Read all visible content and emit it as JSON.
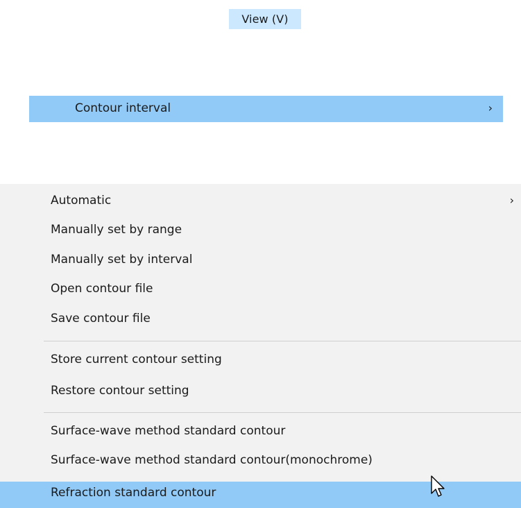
{
  "menubar": {
    "view_label": "View (V)"
  },
  "parent_menu": {
    "contour_interval_label": "Contour interval",
    "contour_interval_arrow": "›"
  },
  "submenu": {
    "automatic": "Automatic",
    "automatic_arrow": "›",
    "manual_range": "Manually set by range",
    "manual_interval": "Manually set by interval",
    "open_file": "Open contour file",
    "save_file": "Save contour file",
    "store_setting": "Store current contour setting",
    "restore_setting": "Restore contour setting",
    "surface_wave_standard": "Surface-wave method standard contour",
    "surface_wave_mono": "Surface-wave method standard contour(monochrome)",
    "refraction_standard": "Refraction standard contour"
  },
  "colors": {
    "highlight": "#91c9f7",
    "menu_hover_top": "#cce8ff",
    "submenu_bg": "#f2f2f2",
    "separator": "#cfcfcf"
  },
  "icons": {
    "cursor": "mouse-pointer-icon",
    "submenu_arrow": "chevron-right-icon"
  }
}
